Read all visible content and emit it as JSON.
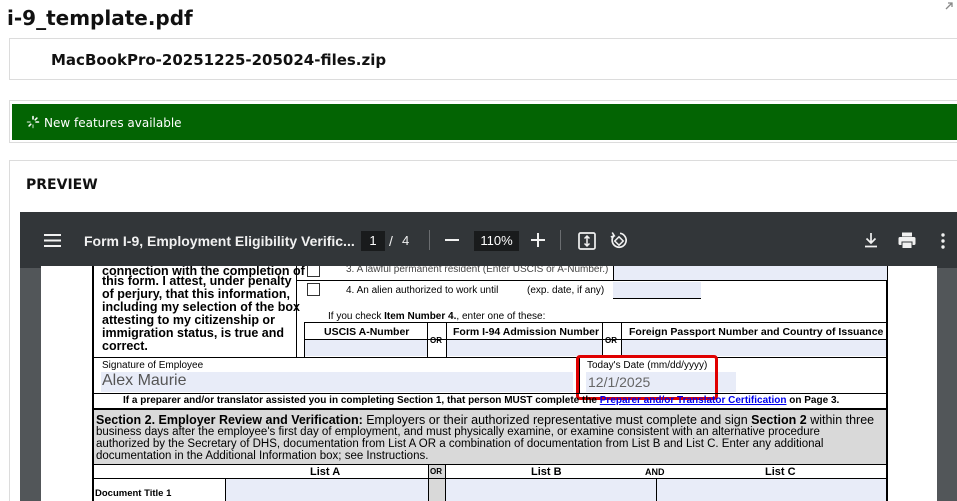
{
  "header": {
    "title": "i-9_template.pdf"
  },
  "attachment": {
    "name": "MacBookPro-20251225-205024-files.zip"
  },
  "banner": {
    "text": "New features available",
    "color": "#036403"
  },
  "preview": {
    "label": "PREVIEW"
  },
  "pdf_viewer": {
    "doc_title": "Form I-9, Employment Eligibility Verific...",
    "page_current": "1",
    "page_sep": "/",
    "page_total": "4",
    "zoom": "110%",
    "icons": [
      "menu-icon",
      "minus-icon",
      "plus-icon",
      "fit-page-icon",
      "rotate-icon",
      "download-icon",
      "print-icon",
      "more-vert-icon"
    ]
  },
  "form": {
    "attest_lines": [
      "connection with the completion of",
      "this form.  I attest, under penalty",
      "of perjury, that this information,",
      "including my selection of the box",
      "attesting to my citizenship or",
      "immigration status, is true and",
      "correct."
    ],
    "opt3": "3.   A lawful permanent resident (Enter USCIS or A-Number.)",
    "opt4": "4.   An alien authorized to work until",
    "opt4_exp": "(exp. date, if any)",
    "item4_pre": "If you check ",
    "item4_bold": "Item Number 4.",
    "item4_post": ", enter one of these:",
    "col_uscis": "USCIS A-Number",
    "col_i94": "Form I-94 Admission Number",
    "col_passport": "Foreign Passport Number and Country of Issuance",
    "or": "OR",
    "sig_label": "Signature of Employee",
    "sig_value": "Alex Maurie",
    "date_label": "Today's Date (mm/dd/yyyy)",
    "date_value": "12/1/2025",
    "preparer_pre": "If a preparer and/or translator assisted you in completing Section 1, that person MUST complete the ",
    "preparer_link": "Preparer and/or Translator Certification",
    "preparer_post": " on Page 3.",
    "sec2_title": "Section 2. Employer Review and Verification:",
    "sec2_line1_rest": " Employers or their authorized representative must complete and sign ",
    "sec2_bold2": "Section 2",
    "sec2_line1_end": " within three",
    "sec2_line2": "business days after the employee's first day of employment, and must physically examine, or examine consistent with an alternative procedure",
    "sec2_line3": "authorized by the Secretary of DHS, documentation from List A OR a combination of documentation from List B and List C.  Enter any additional",
    "sec2_line4": "documentation in the Additional Information box; see Instructions.",
    "list_a": "List A",
    "list_or": "OR",
    "list_b": "List B",
    "list_and": "AND",
    "list_c": "List C",
    "doc_title_1": "Document Title 1"
  }
}
